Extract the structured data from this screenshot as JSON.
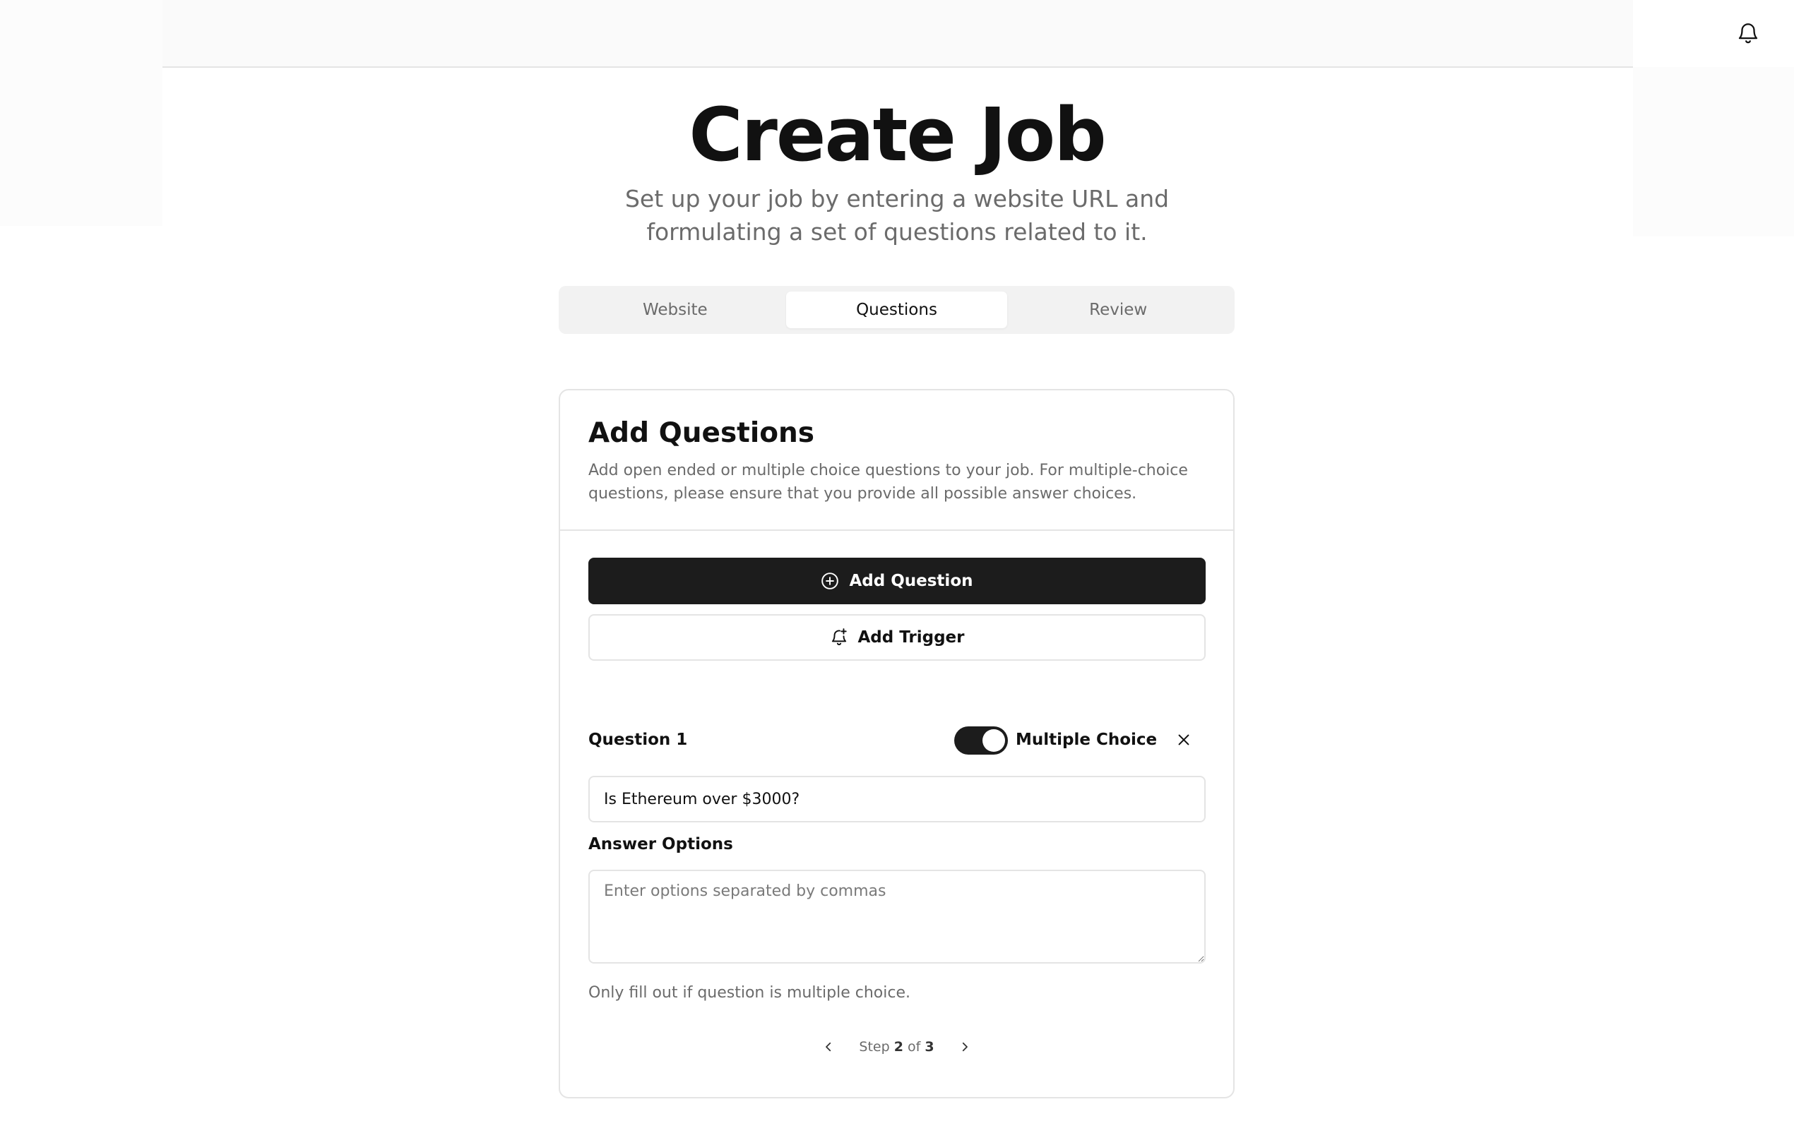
{
  "header": {
    "icon": "bell-icon"
  },
  "page": {
    "title": "Create Job",
    "subtitle": "Set up your job by entering a website URL and formulating a set of questions related to it."
  },
  "tabs": [
    {
      "label": "Website",
      "active": false
    },
    {
      "label": "Questions",
      "active": true
    },
    {
      "label": "Review",
      "active": false
    }
  ],
  "card": {
    "title": "Add Questions",
    "description": "Add open ended or multiple choice questions to your job. For multiple-choice questions, please ensure that you provide all possible answer choices.",
    "add_question_label": "Add Question",
    "add_question_icon": "plus-circle-icon",
    "add_trigger_label": "Add Trigger",
    "add_trigger_icon": "bell-plus-icon"
  },
  "question": {
    "label": "Question 1",
    "multiple_choice_label": "Multiple Choice",
    "multiple_choice_on": true,
    "value": "Is Ethereum over $3000?",
    "answer_options_label": "Answer Options",
    "answer_options_placeholder": "Enter options separated by commas",
    "answer_options_value": "",
    "help_text": "Only fill out if question is multiple choice."
  },
  "pager": {
    "step_word": "Step",
    "current": "2",
    "of_word": "of",
    "total": "3"
  },
  "colors": {
    "primary": "#1c1c1c",
    "muted_text": "#6b6b6b",
    "border": "#e4e4e4",
    "tab_bg": "#f2f2f2"
  }
}
